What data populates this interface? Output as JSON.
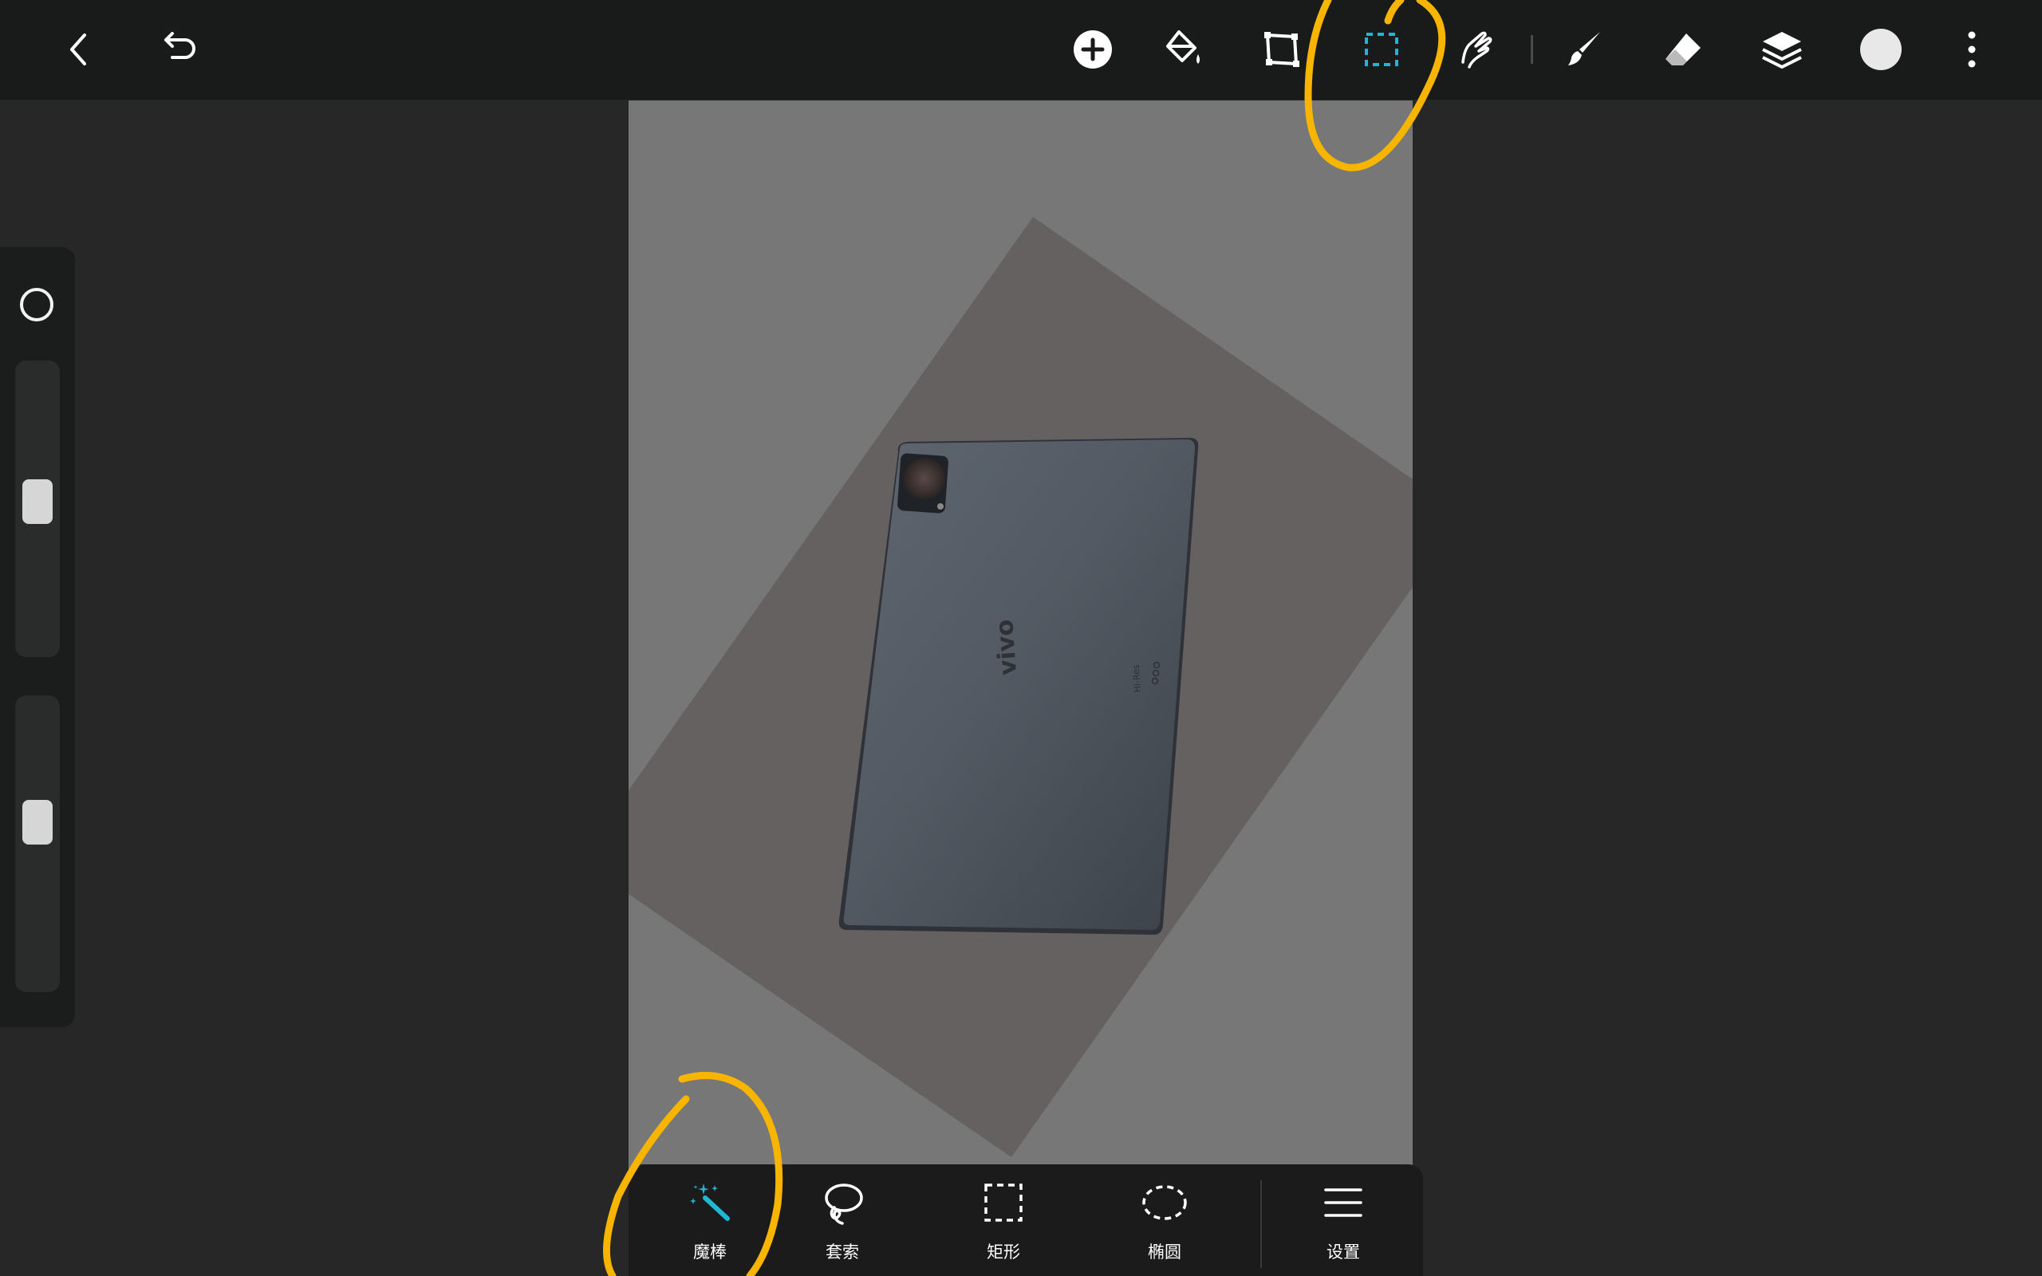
{
  "topbar": {
    "left_icons": [
      "back-arrow-icon",
      "undo-icon"
    ],
    "right_icons": [
      "add-icon",
      "paint-bucket-icon",
      "transform-icon",
      "selection-rect-icon",
      "smudge-icon",
      "brush-icon",
      "eraser-icon",
      "layers-icon",
      "color-swatch-icon",
      "more-vertical-icon"
    ],
    "active_tool": "selection-rect-icon",
    "current_color": "#e8e8e8"
  },
  "side_panel": {
    "brush_size": 0.47,
    "opacity": 0.41
  },
  "canvas": {
    "tablet_brand": "vivo",
    "tablet_badge": "Hi-Res"
  },
  "selection_menu": {
    "items": [
      {
        "id": "magic-wand",
        "label": "魔棒",
        "icon": "magic-wand-icon",
        "active": true
      },
      {
        "id": "lasso",
        "label": "套索",
        "icon": "lasso-icon",
        "active": false
      },
      {
        "id": "rectangle",
        "label": "矩形",
        "icon": "rect-select-icon",
        "active": false
      },
      {
        "id": "ellipse",
        "label": "椭圆",
        "icon": "ellipse-select-icon",
        "active": false
      },
      {
        "id": "settings",
        "label": "设置",
        "icon": "menu-icon",
        "active": false
      }
    ]
  },
  "colors": {
    "accent": "#1fb7d4",
    "annotation": "#f7b500"
  }
}
